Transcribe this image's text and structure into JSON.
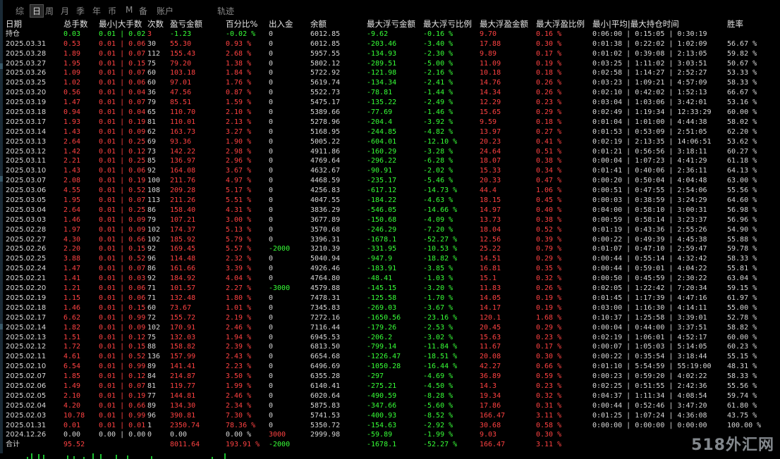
{
  "tabs": [
    "综",
    "日",
    "周",
    "月",
    "季",
    "年",
    "币",
    "M",
    "备",
    "账户",
    "轨迹"
  ],
  "active_tab": "日",
  "headers": [
    "日期",
    "总手数",
    "最小|大手数",
    "次数",
    "盈亏金额",
    "百分比%",
    "出入金",
    "余额",
    "最大浮亏金额",
    "最大浮亏比例",
    "最大浮盈金额",
    "最大浮盈比例",
    "最小|平均|最大持仓时间",
    "胜率"
  ],
  "holding": [
    "持仓",
    "0.03",
    "0.01 | 0.02",
    "3",
    "-1.23",
    "-0.02 %",
    "0",
    "6012.85",
    "-9.62",
    "-0.16 %",
    "9.70",
    "0.16 %",
    "0:06:00 | 0:15:05 | 0:30:19",
    ""
  ],
  "rows": [
    [
      "2025.03.31",
      "0.53",
      "0.01 | 0.06",
      "30",
      "55.30",
      "0.93 %",
      "0",
      "6012.85",
      "-203.46",
      "-3.40 %",
      "17.88",
      "0.30 %",
      "0:01:38 | 0:22:02 | 1:02:09",
      "56.67 %"
    ],
    [
      "2025.03.28",
      "1.89",
      "0.01 | 0.07",
      "112",
      "155.43",
      "2.68 %",
      "0",
      "5957.55",
      "-134.93",
      "-2.30 %",
      "9.89",
      "0.17 %",
      "0:01:02 | 0:39:08 | 2:13:05",
      "59.82 %"
    ],
    [
      "2025.03.27",
      "1.95",
      "0.01 | 0.15",
      "75",
      "79.20",
      "1.38 %",
      "0",
      "5802.12",
      "-289.51",
      "-5.00 %",
      "11.09",
      "0.19 %",
      "0:03:25 | 1:11:02 | 3:03:51",
      "50.67 %"
    ],
    [
      "2025.03.26",
      "1.09",
      "0.01 | 0.07",
      "60",
      "103.18",
      "1.84 %",
      "0",
      "5722.92",
      "-121.98",
      "-2.16 %",
      "10.18",
      "0.18 %",
      "0:02:58 | 1:14:27 | 2:52:27",
      "53.33 %"
    ],
    [
      "2025.03.25",
      "1.02",
      "0.01 | 0.06",
      "60",
      "97.01",
      "1.76 %",
      "0",
      "5619.74",
      "-134.34",
      "-2.41 %",
      "14.76",
      "0.26 %",
      "0:03:23 | 1:09:21 | 4:57:09",
      "58.33 %"
    ],
    [
      "2025.03.20",
      "0.56",
      "0.01 | 0.04",
      "36",
      "47.56",
      "0.87 %",
      "0",
      "5522.73",
      "-78.81",
      "-1.44 %",
      "14.34",
      "0.26 %",
      "0:02:10 | 0:42:02 | 1:52:13",
      "66.67 %"
    ],
    [
      "2025.03.19",
      "1.47",
      "0.01 | 0.07",
      "79",
      "85.51",
      "1.59 %",
      "0",
      "5475.17",
      "-135.22",
      "-2.49 %",
      "12.29",
      "0.23 %",
      "0:03:04 | 1:03:06 | 3:42:01",
      "53.16 %"
    ],
    [
      "2025.03.18",
      "0.94",
      "0.01 | 0.04",
      "65",
      "110.70",
      "2.10 %",
      "0",
      "5389.66",
      "-77.69",
      "-1.46 %",
      "15.65",
      "0.29 %",
      "0:02:49 | 1:19:34 | 12:33:29",
      "60.00 %"
    ],
    [
      "2025.03.17",
      "1.93",
      "0.01 | 0.19",
      "81",
      "110.01",
      "2.13 %",
      "0",
      "5278.96",
      "-204.4",
      "-3.92 %",
      "9.59",
      "0.18 %",
      "0:01:04 | 1:01:00 | 4:44:38",
      "58.02 %"
    ],
    [
      "2025.03.14",
      "1.43",
      "0.01 | 0.09",
      "62",
      "163.73",
      "3.27 %",
      "0",
      "5168.95",
      "-244.85",
      "-4.82 %",
      "13.97",
      "0.27 %",
      "0:01:53 | 0:53:09 | 2:51:05",
      "62.20 %"
    ],
    [
      "2025.03.13",
      "2.64",
      "0.01 | 0.25",
      "69",
      "93.36",
      "1.90 %",
      "0",
      "5005.22",
      "-604.01",
      "-12.10 %",
      "20.23",
      "0.41 %",
      "0:02:19 | 2:13:35 | 14:06:51",
      "53.62 %"
    ],
    [
      "2025.03.12",
      "1.42",
      "0.01 | 0.12",
      "73",
      "142.22",
      "2.98 %",
      "0",
      "4911.86",
      "-160.29",
      "-3.28 %",
      "24.64",
      "0.51 %",
      "0:01:21 | 0:56:56 | 3:18:11",
      "60.27 %"
    ],
    [
      "2025.03.11",
      "2.21",
      "0.01 | 0.25",
      "85",
      "136.97",
      "2.96 %",
      "0",
      "4769.64",
      "-296.22",
      "-6.28 %",
      "18.07",
      "0.38 %",
      "0:00:04 | 1:07:23 | 4:41:29",
      "61.18 %"
    ],
    [
      "2025.03.10",
      "1.43",
      "0.01 | 0.06",
      "92",
      "164.08",
      "3.67 %",
      "0",
      "4632.67",
      "-90.91",
      "-2.02 %",
      "15.33",
      "0.34 %",
      "0:01:41 | 0:40:06 | 2:36:11",
      "64.13 %"
    ],
    [
      "2025.03.07",
      "2.08",
      "0.01 | 0.19",
      "100",
      "211.76",
      "4.97 %",
      "0",
      "4468.59",
      "-235.17",
      "-5.46 %",
      "20.33",
      "0.47 %",
      "0:00:20 | 0:50:04 | 4:04:48",
      "63.00 %"
    ],
    [
      "2025.03.06",
      "4.55",
      "0.01 | 0.52",
      "108",
      "209.28",
      "5.17 %",
      "0",
      "4256.83",
      "-617.12",
      "-14.73 %",
      "44.4",
      "1.06 %",
      "0:00:51 | 0:47:55 | 2:54:06",
      "55.56 %"
    ],
    [
      "2025.03.05",
      "1.95",
      "0.01 | 0.07",
      "113",
      "211.26",
      "5.51 %",
      "0",
      "4047.55",
      "-184.22",
      "-4.63 %",
      "18.15",
      "0.45 %",
      "0:00:03 | 0:38:59 | 3:24:29",
      "64.60 %"
    ],
    [
      "2025.03.04",
      "2.64",
      "0.01 | 0.25",
      "86",
      "158.40",
      "4.31 %",
      "0",
      "3836.29",
      "-546.05",
      "-14.66 %",
      "14.97",
      "0.40 %",
      "0:04:00 | 0:58:10 | 3:00:31",
      "56.98 %"
    ],
    [
      "2025.03.03",
      "1.46",
      "0.01 | 0.09",
      "79",
      "107.21",
      "3.00 %",
      "0",
      "3677.89",
      "-150.68",
      "-4.09 %",
      "13.73",
      "0.38 %",
      "0:00:59 | 0:58:14 | 3:23:37",
      "56.96 %"
    ],
    [
      "2025.02.28",
      "1.97",
      "0.01 | 0.09",
      "102",
      "174.37",
      "5.13 %",
      "0",
      "3570.68",
      "-246.29",
      "-7.20 %",
      "18.04",
      "0.52 %",
      "0:01:19 | 0:43:36 | 2:55:26",
      "54.90 %"
    ],
    [
      "2025.02.27",
      "4.30",
      "0.01 | 0.66",
      "102",
      "185.92",
      "5.79 %",
      "0",
      "3396.31",
      "-1678.1",
      "-52.27 %",
      "12.56",
      "0.39 %",
      "0:00:22 | 0:49:39 | 4:45:38",
      "55.88 %"
    ],
    [
      "2025.02.26",
      "2.20",
      "0.01 | 0.15",
      "92",
      "169.45",
      "5.57 %",
      "-2000",
      "3210.39",
      "-331.95",
      "-10.53 %",
      "25.22",
      "0.79 %",
      "0:01:07 | 0:47:10 | 2:59:47",
      "59.78 %"
    ],
    [
      "2025.02.25",
      "3.88",
      "0.01 | 0.52",
      "96",
      "114.48",
      "2.32 %",
      "0",
      "5040.94",
      "-947.9",
      "-18.82 %",
      "14.51",
      "0.29 %",
      "0:00:44 | 0:55:14 | 4:32:42",
      "58.33 %"
    ],
    [
      "2025.02.24",
      "1.47",
      "0.01 | 0.07",
      "86",
      "161.66",
      "3.39 %",
      "0",
      "4926.46",
      "-183.91",
      "-3.85 %",
      "16.81",
      "0.35 %",
      "0:00:44 | 0:59:01 | 4:04:22",
      "55.81 %"
    ],
    [
      "2025.02.21",
      "1.41",
      "0.01 | 0.03",
      "92",
      "184.92",
      "4.04 %",
      "0",
      "4764.80",
      "-48.41",
      "-1.03 %",
      "15.1",
      "0.32 %",
      "0:00:50 | 0:45:59 | 2:30:22",
      "63.04 %"
    ],
    [
      "2025.02.20",
      "1.21",
      "0.01 | 0.06",
      "71",
      "101.57",
      "2.27 %",
      "-3000",
      "4579.88",
      "-145.15",
      "-3.20 %",
      "11.83",
      "0.26 %",
      "0:02:05 | 1:22:42 | 7:20:34",
      "59.15 %"
    ],
    [
      "2025.02.19",
      "1.15",
      "0.01 | 0.06",
      "71",
      "132.48",
      "1.80 %",
      "0",
      "7478.31",
      "-125.58",
      "-1.70 %",
      "14.05",
      "0.19 %",
      "0:01:45 | 1:17:39 | 4:47:16",
      "61.97 %"
    ],
    [
      "2025.02.18",
      "1.46",
      "0.01 | 0.15",
      "60",
      "73.67",
      "1.01 %",
      "0",
      "7345.83",
      "-269.03",
      "-3.67 %",
      "14.17",
      "0.19 %",
      "0:03:00 | 1:16:30 | 4:14:11",
      "55.00 %"
    ],
    [
      "2025.02.17",
      "6.62",
      "0.01 | 0.99",
      "72",
      "155.72",
      "2.19 %",
      "0",
      "7272.16",
      "-1650.56",
      "-23.16 %",
      "120.1",
      "1.68 %",
      "0:10:37 | 1:25:58 | 3:39:01",
      "52.78 %"
    ],
    [
      "2025.02.14",
      "1.82",
      "0.01 | 0.09",
      "102",
      "170.91",
      "2.46 %",
      "0",
      "7116.44",
      "-179.26",
      "-2.53 %",
      "20.45",
      "0.29 %",
      "0:00:04 | 0:44:00 | 3:37:51",
      "58.82 %"
    ],
    [
      "2025.02.13",
      "1.51",
      "0.01 | 0.12",
      "75",
      "132.03",
      "1.94 %",
      "0",
      "6945.53",
      "-206.2",
      "-3.02 %",
      "15.63",
      "0.23 %",
      "0:02:19 | 1:06:01 | 4:52:17",
      "60.00 %"
    ],
    [
      "2025.02.12",
      "1.72",
      "0.01 | 0.15",
      "88",
      "158.82",
      "2.39 %",
      "0",
      "6813.50",
      "-799.14",
      "-11.84 %",
      "11.67",
      "0.17 %",
      "0:00:07 | 1:05:03 | 5:14:05",
      "60.23 %"
    ],
    [
      "2025.02.11",
      "4.61",
      "0.01 | 0.52",
      "136",
      "157.99",
      "2.43 %",
      "0",
      "6654.68",
      "-1226.47",
      "-18.51 %",
      "20.08",
      "0.30 %",
      "0:00:22 | 0:35:54 | 3:18:44",
      "55.15 %"
    ],
    [
      "2025.02.10",
      "6.54",
      "0.01 | 0.99",
      "89",
      "141.41",
      "2.23 %",
      "0",
      "6496.69",
      "-1050.28",
      "-16.44 %",
      "42.27",
      "0.66 %",
      "0:01:10 | 5:54:59 | 55:19:00",
      "48.31 %"
    ],
    [
      "2025.02.07",
      "1.85",
      "0.01 | 0.12",
      "84",
      "214.87",
      "3.50 %",
      "0",
      "6355.28",
      "-297",
      "-4.69 %",
      "36.89",
      "0.59 %",
      "0:00:23 | 0:59:20 | 4:02:22",
      "58.33 %"
    ],
    [
      "2025.02.06",
      "1.49",
      "0.01 | 0.07",
      "81",
      "119.77",
      "1.99 %",
      "0",
      "6140.41",
      "-275.21",
      "-4.50 %",
      "14.3",
      "0.23 %",
      "0:02:25 | 0:51:55 | 2:42:36",
      "55.56 %"
    ],
    [
      "2025.02.05",
      "2.10",
      "0.01 | 0.19",
      "77",
      "144.81",
      "2.46 %",
      "0",
      "6020.64",
      "-490.59",
      "-8.28 %",
      "19.34",
      "0.32 %",
      "0:04:37 | 1:11:34 | 4:08:54",
      "59.74 %"
    ],
    [
      "2025.02.04",
      "4.20",
      "0.01 | 0.66",
      "89",
      "134.30",
      "2.34 %",
      "0",
      "5875.83",
      "-347.66",
      "-5.60 %",
      "17.86",
      "0.31 %",
      "0:00:44 | 0:52:46 | 3:47:20",
      "61.80 %"
    ],
    [
      "2025.02.03",
      "10.78",
      "0.01 | 0.99",
      "96",
      "390.81",
      "7.30 %",
      "0",
      "5741.53",
      "-400.93",
      "-8.52 %",
      "166.47",
      "3.11 %",
      "0:01:25 | 1:07:24 | 4:36:08",
      "43.75 %"
    ],
    [
      "2025.01.31",
      "0.01",
      "0.01 | 0.01",
      "1",
      "2350.74",
      "78.36 %",
      "0",
      "5350.72",
      "-154.63",
      "-2.92 %",
      "30.68",
      "0.58 %",
      "0:00:00 | 0:00:00 | 0:00:00",
      "100.00 %"
    ],
    [
      "2024.12.26",
      "0.00",
      "0.00 | 0.00",
      "0",
      "0.00",
      "0.00 %",
      "3000",
      "2999.98",
      "-59.89",
      "-1.99 %",
      "9.03",
      "0.30 %",
      "",
      ""
    ]
  ],
  "totals": [
    "合计",
    "95.52",
    "",
    "",
    "8011.64",
    "193.91 %",
    "-2000",
    "",
    "-1678.1",
    "-52.27 %",
    "166.47",
    "3.11 %",
    "",
    ""
  ],
  "watermark": "518外汇网",
  "colors": {
    "positive": "#ff4242",
    "negative": "#37ff37",
    "neutral": "#d8d8d8",
    "background": "#000000"
  }
}
